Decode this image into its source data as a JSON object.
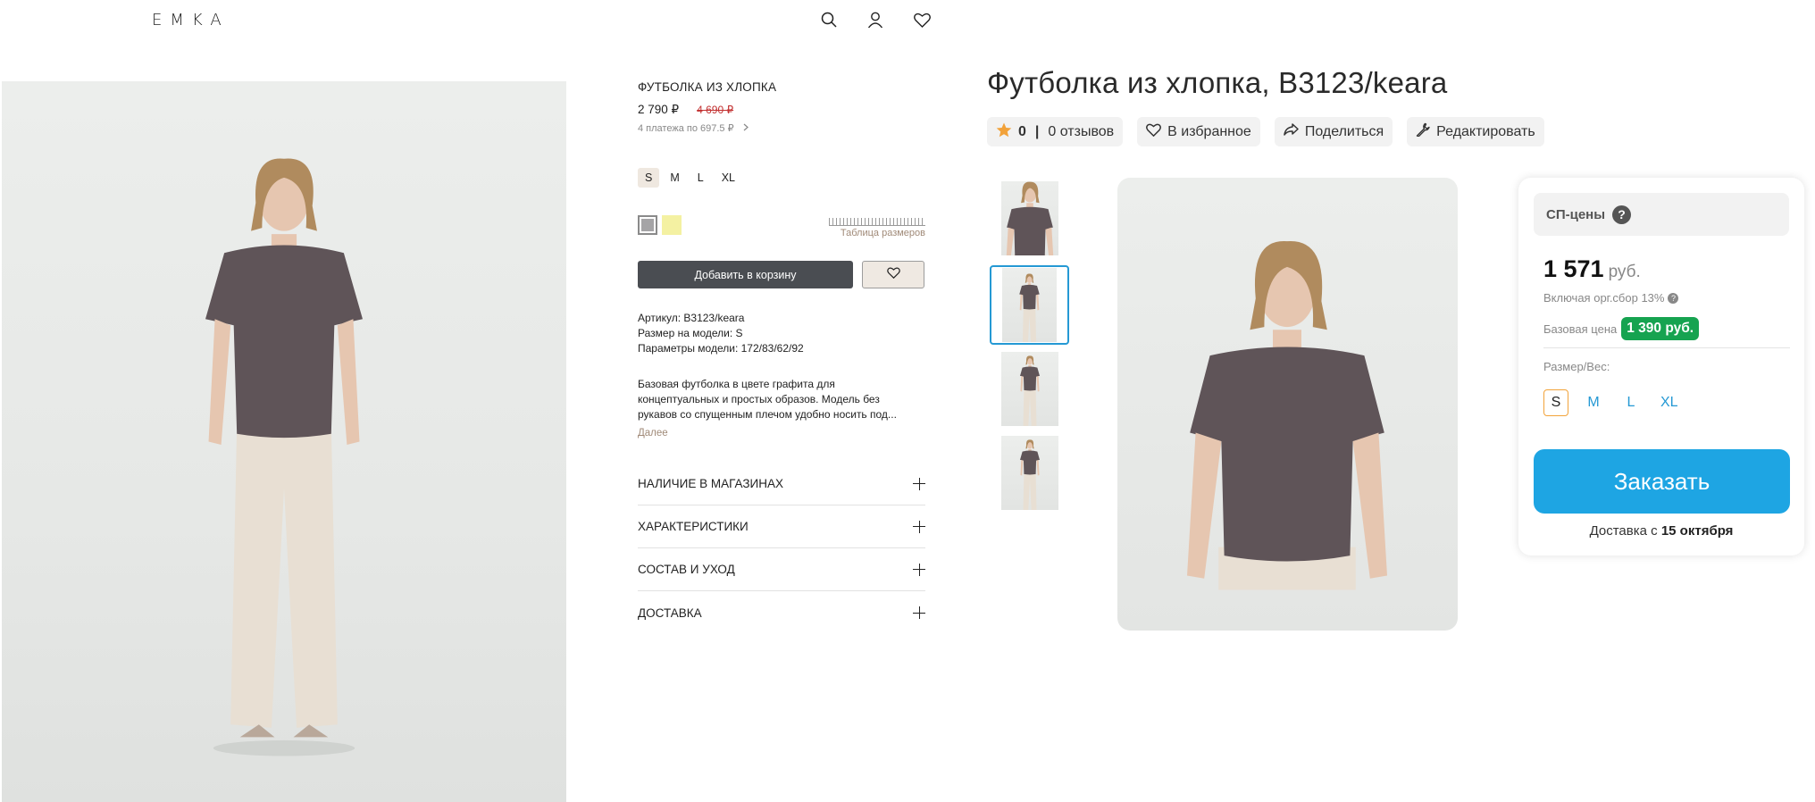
{
  "store": {
    "logo": "EMKA",
    "product": {
      "title": "ФУТБОЛКА ИЗ ХЛОПКА",
      "price": "2 790 ₽",
      "old_price": "4 690 ₽",
      "installments": "4 платежа по 697.5 ₽",
      "sizes": [
        "S",
        "M",
        "L",
        "XL"
      ],
      "selected_size": "S",
      "colors": [
        "#a5a4a6",
        "#f4f1a2"
      ],
      "size_chart_label": "Таблица размеров",
      "add_to_cart": "Добавить в корзину",
      "specs": [
        "Артикул: B3123/keara",
        "Размер на модели: S",
        "Параметры модели: 172/83/62/92"
      ],
      "description_lines": [
        "Базовая футболка в цвете графита для",
        "концептуальных и простых образов. Модель без",
        "рукавов со спущенным плечом удобно носить под..."
      ],
      "more": "Далее",
      "accordion": [
        "НАЛИЧИЕ В МАГАЗИНАХ",
        "ХАРАКТЕРИСТИКИ",
        "СОСТАВ И УХОД",
        "ДОСТАВКА"
      ]
    }
  },
  "sp": {
    "title": "Футболка из хлопка, B3123/keara",
    "rating": "0",
    "reviews": "0 отзывов",
    "favorite": "В избранное",
    "share": "Поделиться",
    "edit": "Редактировать",
    "price_header": "СП-цены",
    "price": "1 571",
    "currency": "руб.",
    "fee_text": "Включая орг.сбор 13%",
    "base_price_label": "Базовая цена",
    "base_price": "1 390 руб.",
    "size_label": "Размер/Вес:",
    "sizes": [
      "S",
      "M",
      "L",
      "XL"
    ],
    "selected_size": "S",
    "order_button": "Заказать",
    "delivery_prefix": "Доставка с",
    "delivery_date": "15 октября"
  },
  "colors": {
    "accent_blue": "#1ea5e3",
    "green_badge": "#16a350",
    "old_price_red": "#c23030",
    "dark_button": "#4a4d52",
    "shirt": "#5f5458",
    "trousers": "#e8dfd3"
  }
}
